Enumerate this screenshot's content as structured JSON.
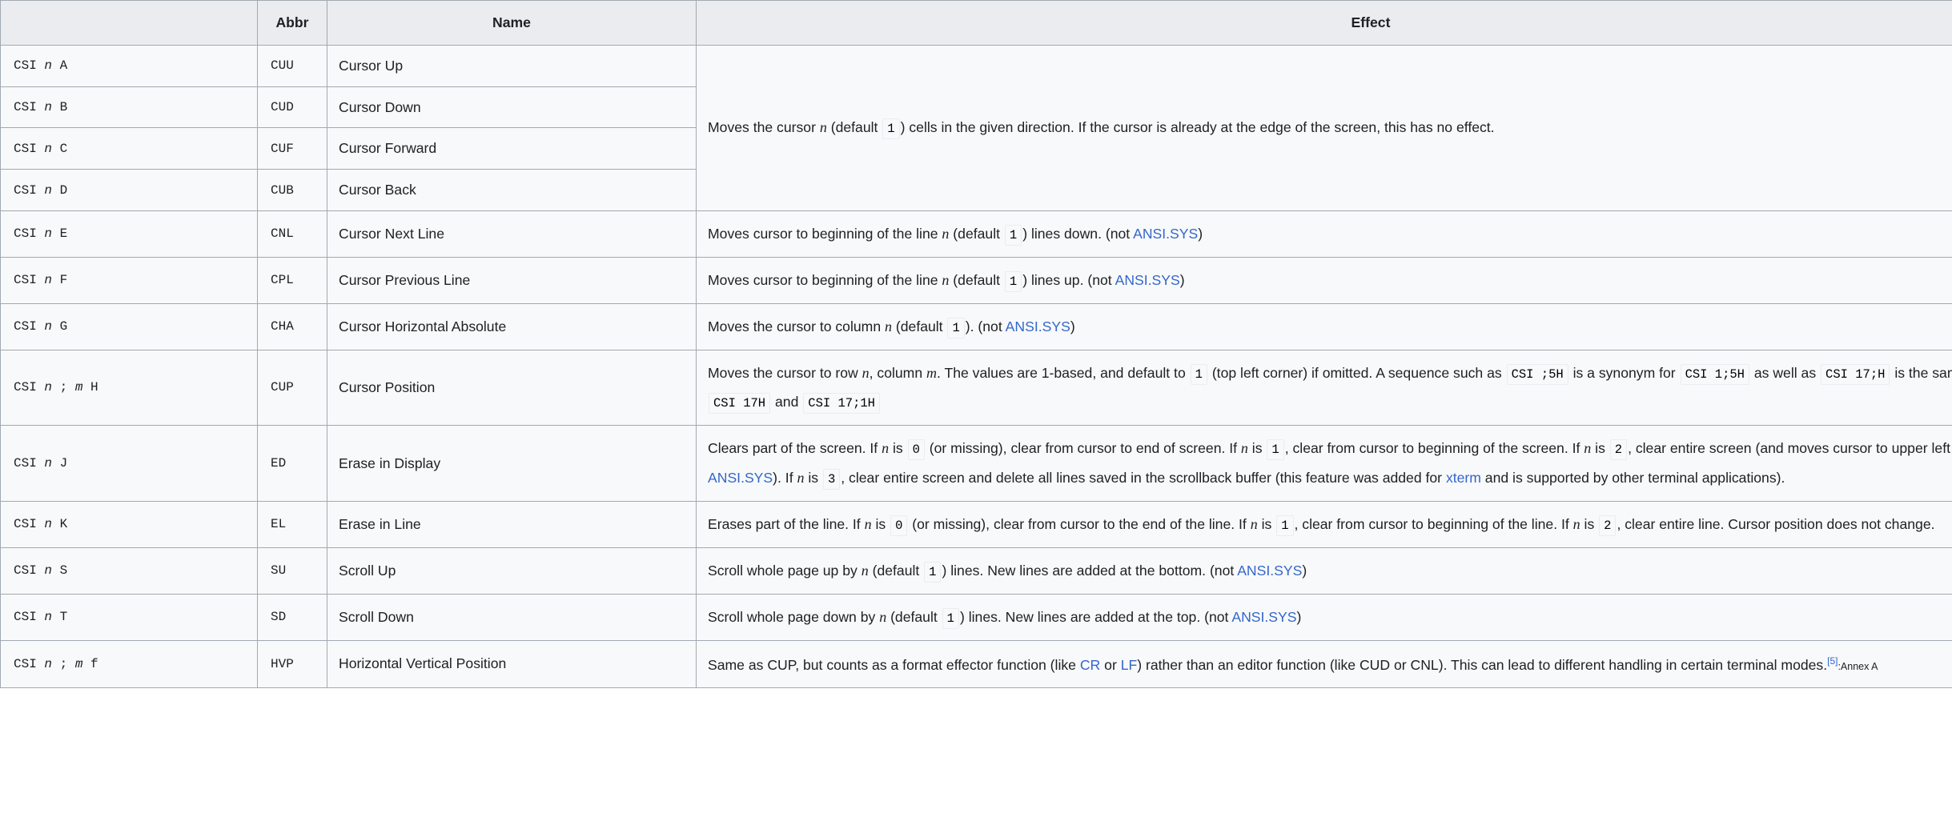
{
  "table": {
    "headers": {
      "sequence": "",
      "abbr": "Abbr",
      "name": "Name",
      "effect": "Effect"
    },
    "colors": {
      "link": "#3366cc",
      "header_bg": "#eaecf0",
      "cell_bg": "#f8f9fa",
      "border": "#a2a9b1"
    },
    "rows": [
      {
        "seq_prefix": "CSI ",
        "seq_var": "n",
        "seq_suffix": " A",
        "abbr": "CUU",
        "name": "Cursor Up"
      },
      {
        "seq_prefix": "CSI ",
        "seq_var": "n",
        "seq_suffix": " B",
        "abbr": "CUD",
        "name": "Cursor Down"
      },
      {
        "seq_prefix": "CSI ",
        "seq_var": "n",
        "seq_suffix": " C",
        "abbr": "CUF",
        "name": "Cursor Forward"
      },
      {
        "seq_prefix": "CSI ",
        "seq_var": "n",
        "seq_suffix": " D",
        "abbr": "CUB",
        "name": "Cursor Back"
      },
      {
        "seq_prefix": "CSI ",
        "seq_var": "n",
        "seq_suffix": " E",
        "abbr": "CNL",
        "name": "Cursor Next Line"
      },
      {
        "seq_prefix": "CSI ",
        "seq_var": "n",
        "seq_suffix": " F",
        "abbr": "CPL",
        "name": "Cursor Previous Line"
      },
      {
        "seq_prefix": "CSI ",
        "seq_var": "n",
        "seq_suffix": " G",
        "abbr": "CHA",
        "name": "Cursor Horizontal Absolute"
      },
      {
        "seq_prefix": "CSI ",
        "seq_var": "n",
        "seq_mid": " ; ",
        "seq_var2": "m",
        "seq_suffix": " H",
        "abbr": "CUP",
        "name": "Cursor Position"
      },
      {
        "seq_prefix": "CSI ",
        "seq_var": "n",
        "seq_suffix": " J",
        "abbr": "ED",
        "name": "Erase in Display"
      },
      {
        "seq_prefix": "CSI ",
        "seq_var": "n",
        "seq_suffix": " K",
        "abbr": "EL",
        "name": "Erase in Line"
      },
      {
        "seq_prefix": "CSI ",
        "seq_var": "n",
        "seq_suffix": " S",
        "abbr": "SU",
        "name": "Scroll Up"
      },
      {
        "seq_prefix": "CSI ",
        "seq_var": "n",
        "seq_suffix": " T",
        "abbr": "SD",
        "name": "Scroll Down"
      },
      {
        "seq_prefix": "CSI ",
        "seq_var": "n",
        "seq_mid": " ; ",
        "seq_var2": "m",
        "seq_suffix": " f",
        "abbr": "HVP",
        "name": "Horizontal Vertical Position"
      }
    ],
    "effects": {
      "move_cursor": {
        "t1": "Moves the cursor ",
        "v1": "n",
        "t2": " (default ",
        "c1": "1",
        "t3": ") cells in the given direction. If the cursor is already at the edge of the screen, this has no effect."
      },
      "cnl": {
        "t1": "Moves cursor to beginning of the line ",
        "v1": "n",
        "t2": " (default ",
        "c1": "1",
        "t3": ") lines down. (not ",
        "link": "ANSI.SYS",
        "t4": ")"
      },
      "cpl": {
        "t1": "Moves cursor to beginning of the line ",
        "v1": "n",
        "t2": " (default ",
        "c1": "1",
        "t3": ") lines up. (not ",
        "link": "ANSI.SYS",
        "t4": ")"
      },
      "cha": {
        "t1": "Moves the cursor to column ",
        "v1": "n",
        "t2": " (default ",
        "c1": "1",
        "t3": "). (not ",
        "link": "ANSI.SYS",
        "t4": ")"
      },
      "cup": {
        "t1": "Moves the cursor to row ",
        "v1": "n",
        "t2": ", column ",
        "v2": "m",
        "t3": ". The values are 1-based, and default to ",
        "c1": "1",
        "t4": " (top left corner) if omitted. A sequence such as ",
        "c2": "CSI ;5H",
        "t5": " is a synonym for ",
        "c3": "CSI 1;5H",
        "t6": " as well as ",
        "c4": "CSI 17;H",
        "t7": " is the same as ",
        "c5": "CSI 17H",
        "t8": " and ",
        "c6": "CSI 17;1H"
      },
      "ed": {
        "t1": "Clears part of the screen. If ",
        "v1": "n",
        "t2": " is ",
        "c1": "0",
        "t3": " (or missing), clear from cursor to end of screen. If ",
        "v2": "n",
        "t4": " is ",
        "c2": "1",
        "t5": ", clear from cursor to beginning of the screen. If ",
        "v3": "n",
        "t6": " is ",
        "c3": "2",
        "t7": ", clear entire screen (and moves cursor to upper left on DOS ",
        "link1": "ANSI.SYS",
        "t8": "). If ",
        "v4": "n",
        "t9": " is ",
        "c4": "3",
        "t10": ", clear entire screen and delete all lines saved in the scrollback buffer (this feature was added for ",
        "link2": "xterm",
        "t11": " and is supported by other terminal applications)."
      },
      "el": {
        "t1": "Erases part of the line. If ",
        "v1": "n",
        "t2": " is ",
        "c1": "0",
        "t3": " (or missing), clear from cursor to the end of the line. If ",
        "v2": "n",
        "t4": " is ",
        "c2": "1",
        "t5": ", clear from cursor to beginning of the line. If ",
        "v3": "n",
        "t6": " is ",
        "c3": "2",
        "t7": ", clear entire line. Cursor position does not change."
      },
      "su": {
        "t1": "Scroll whole page up by ",
        "v1": "n",
        "t2": " (default ",
        "c1": "1",
        "t3": ") lines. New lines are added at the bottom. (not ",
        "link": "ANSI.SYS",
        "t4": ")"
      },
      "sd": {
        "t1": "Scroll whole page down by ",
        "v1": "n",
        "t2": " (default ",
        "c1": "1",
        "t3": ") lines. New lines are added at the top. (not ",
        "link": "ANSI.SYS",
        "t4": ")"
      },
      "hvp": {
        "t1": "Same as CUP, but counts as a format effector function (like ",
        "link1": "CR",
        "t2": " or ",
        "link2": "LF",
        "t3": ") rather than an editor function (like CUD or CNL). This can lead to different handling in certain terminal modes.",
        "ref": "[5]",
        "ref_suffix": ":Annex A"
      }
    }
  }
}
